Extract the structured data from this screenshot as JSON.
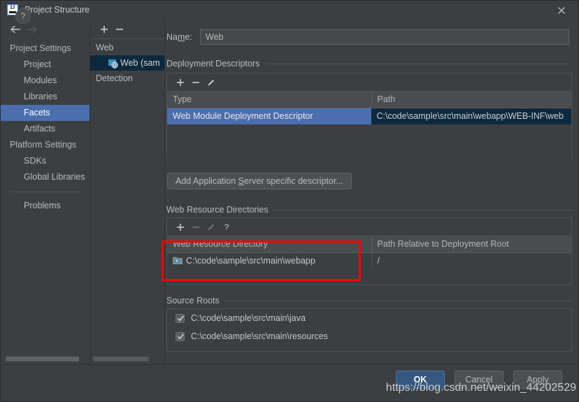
{
  "window": {
    "title": "Project Structure",
    "app_icon": "intellij-idea-icon",
    "close_icon": "close-icon"
  },
  "nav": {
    "back_icon": "arrow-left-icon",
    "forward_icon": "arrow-right-icon",
    "items": [
      {
        "label": "Project Settings",
        "type": "group",
        "selected": false
      },
      {
        "label": "Project",
        "type": "child",
        "selected": false
      },
      {
        "label": "Modules",
        "type": "child",
        "selected": false
      },
      {
        "label": "Libraries",
        "type": "child",
        "selected": false
      },
      {
        "label": "Facets",
        "type": "child",
        "selected": true
      },
      {
        "label": "Artifacts",
        "type": "child",
        "selected": false
      },
      {
        "label": "Platform Settings",
        "type": "group",
        "selected": false
      },
      {
        "label": "SDKs",
        "type": "child",
        "selected": false
      },
      {
        "label": "Global Libraries",
        "type": "child",
        "selected": false
      }
    ],
    "problems_label": "Problems"
  },
  "tree": {
    "add_icon": "plus-icon",
    "remove_icon": "minus-icon",
    "items": [
      {
        "label": "Web",
        "level": 0,
        "selected": false,
        "icon": null
      },
      {
        "label": "Web (sam",
        "level": 1,
        "selected": true,
        "icon": "web-facet-icon"
      },
      {
        "label": "Detection",
        "level": 0,
        "selected": false,
        "icon": null
      }
    ]
  },
  "main": {
    "name": {
      "label_prefix": "Na",
      "label_accel": "m",
      "label_suffix": "e:",
      "value": "Web",
      "placeholder": ""
    },
    "deployment_descriptors": {
      "section_title": "Deployment Descriptors",
      "toolbar": {
        "add_icon": "plus-icon",
        "remove_icon": "minus-icon",
        "edit_icon": "pencil-icon"
      },
      "columns": [
        "Type",
        "Path"
      ],
      "rows": [
        {
          "type": "Web Module Deployment Descriptor",
          "path": "C:\\code\\sample\\src\\main\\webapp\\WEB-INF\\web",
          "selected": true
        }
      ]
    },
    "add_descriptor_button": {
      "prefix": "Add Application ",
      "accel": "S",
      "suffix": "erver specific descriptor..."
    },
    "web_resource_directories": {
      "section_title": "Web Resource Directories",
      "toolbar": {
        "add_icon": "plus-icon",
        "remove_icon": "minus-icon",
        "edit_icon": "pencil-icon",
        "help_icon": "question-icon"
      },
      "columns": [
        "Web Resource Directory",
        "Path Relative to Deployment Root"
      ],
      "rows": [
        {
          "directory": "C:\\code\\sample\\src\\main\\webapp",
          "relative_path": "/",
          "icon": "folder-icon"
        }
      ]
    },
    "source_roots": {
      "section_title": "Source Roots",
      "rows": [
        {
          "label": "C:\\code\\sample\\src\\main\\java",
          "checked": true
        },
        {
          "label": "C:\\code\\sample\\src\\main\\resources",
          "checked": true
        }
      ]
    }
  },
  "footer": {
    "help_label": "?",
    "ok_label": "OK",
    "cancel_label": "Cancel",
    "apply_label": "Apply"
  },
  "watermark": {
    "text": "https://blog.csdn.net/weixin_44202529"
  },
  "colors": {
    "background": "#3c3f41",
    "selection_blue": "#4b6eaf",
    "selection_dark": "#0d293e",
    "annotation_red": "#fe0000",
    "ok_button": "#365880",
    "text": "#bbbbbb"
  }
}
